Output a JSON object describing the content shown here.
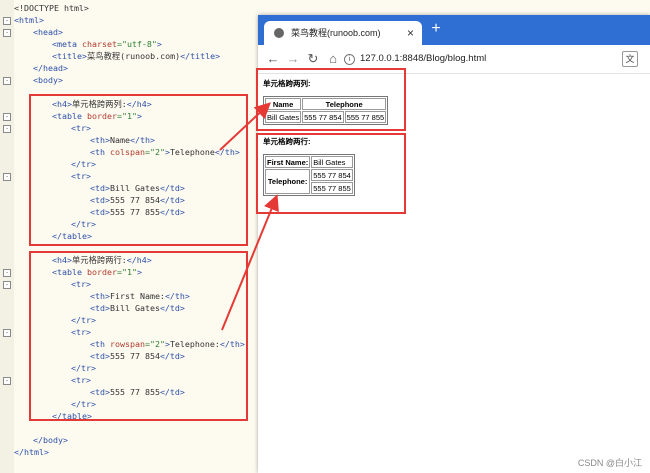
{
  "editor": {
    "lines": [
      {
        "indent": 0,
        "parts": [
          {
            "t": "<!DOCTYPE html>",
            "c": "txt"
          }
        ]
      },
      {
        "indent": 0,
        "fold": "-",
        "parts": [
          {
            "t": "<html>",
            "c": "tag"
          }
        ]
      },
      {
        "indent": 1,
        "fold": "-",
        "parts": [
          {
            "t": "<head>",
            "c": "tag"
          }
        ]
      },
      {
        "indent": 2,
        "parts": [
          {
            "t": "<meta ",
            "c": "tag"
          },
          {
            "t": "charset",
            "c": "attr"
          },
          {
            "t": "=\"utf-8\"",
            "c": "val"
          },
          {
            "t": ">",
            "c": "tag"
          }
        ]
      },
      {
        "indent": 2,
        "parts": [
          {
            "t": "<title>",
            "c": "tag"
          },
          {
            "t": "菜鸟教程(runoob.com)",
            "c": "txt"
          },
          {
            "t": "</title>",
            "c": "tag"
          }
        ]
      },
      {
        "indent": 1,
        "parts": [
          {
            "t": "</head>",
            "c": "tag"
          }
        ]
      },
      {
        "indent": 1,
        "fold": "-",
        "parts": [
          {
            "t": "<body>",
            "c": "tag"
          }
        ]
      },
      {
        "indent": 0,
        "parts": []
      },
      {
        "indent": 2,
        "parts": [
          {
            "t": "<h4>",
            "c": "tag"
          },
          {
            "t": "单元格跨两列:",
            "c": "txt"
          },
          {
            "t": "</h4>",
            "c": "tag"
          }
        ]
      },
      {
        "indent": 2,
        "fold": "-",
        "parts": [
          {
            "t": "<table ",
            "c": "tag"
          },
          {
            "t": "border",
            "c": "attr"
          },
          {
            "t": "=\"1\"",
            "c": "val"
          },
          {
            "t": ">",
            "c": "tag"
          }
        ]
      },
      {
        "indent": 3,
        "fold": "-",
        "parts": [
          {
            "t": "<tr>",
            "c": "tag"
          }
        ]
      },
      {
        "indent": 4,
        "parts": [
          {
            "t": "<th>",
            "c": "tag"
          },
          {
            "t": "Name",
            "c": "txt"
          },
          {
            "t": "</th>",
            "c": "tag"
          }
        ]
      },
      {
        "indent": 4,
        "parts": [
          {
            "t": "<th ",
            "c": "tag"
          },
          {
            "t": "colspan",
            "c": "attr"
          },
          {
            "t": "=\"2\"",
            "c": "val"
          },
          {
            "t": ">",
            "c": "tag"
          },
          {
            "t": "Telephone",
            "c": "txt"
          },
          {
            "t": "</th>",
            "c": "tag"
          }
        ]
      },
      {
        "indent": 3,
        "parts": [
          {
            "t": "</tr>",
            "c": "tag"
          }
        ]
      },
      {
        "indent": 3,
        "fold": "-",
        "parts": [
          {
            "t": "<tr>",
            "c": "tag"
          }
        ]
      },
      {
        "indent": 4,
        "parts": [
          {
            "t": "<td>",
            "c": "tag"
          },
          {
            "t": "Bill Gates",
            "c": "txt"
          },
          {
            "t": "</td>",
            "c": "tag"
          }
        ]
      },
      {
        "indent": 4,
        "parts": [
          {
            "t": "<td>",
            "c": "tag"
          },
          {
            "t": "555 77 854",
            "c": "txt"
          },
          {
            "t": "</td>",
            "c": "tag"
          }
        ]
      },
      {
        "indent": 4,
        "parts": [
          {
            "t": "<td>",
            "c": "tag"
          },
          {
            "t": "555 77 855",
            "c": "txt"
          },
          {
            "t": "</td>",
            "c": "tag"
          }
        ]
      },
      {
        "indent": 3,
        "parts": [
          {
            "t": "</tr>",
            "c": "tag"
          }
        ]
      },
      {
        "indent": 2,
        "parts": [
          {
            "t": "</table>",
            "c": "tag"
          }
        ]
      },
      {
        "indent": 0,
        "parts": []
      },
      {
        "indent": 2,
        "parts": [
          {
            "t": "<h4>",
            "c": "tag"
          },
          {
            "t": "单元格跨两行:",
            "c": "txt"
          },
          {
            "t": "</h4>",
            "c": "tag"
          }
        ]
      },
      {
        "indent": 2,
        "fold": "-",
        "parts": [
          {
            "t": "<table ",
            "c": "tag"
          },
          {
            "t": "border",
            "c": "attr"
          },
          {
            "t": "=\"1\"",
            "c": "val"
          },
          {
            "t": ">",
            "c": "tag"
          }
        ]
      },
      {
        "indent": 3,
        "fold": "-",
        "parts": [
          {
            "t": "<tr>",
            "c": "tag"
          }
        ]
      },
      {
        "indent": 4,
        "parts": [
          {
            "t": "<th>",
            "c": "tag"
          },
          {
            "t": "First Name:",
            "c": "txt"
          },
          {
            "t": "</th>",
            "c": "tag"
          }
        ]
      },
      {
        "indent": 4,
        "parts": [
          {
            "t": "<td>",
            "c": "tag"
          },
          {
            "t": "Bill Gates",
            "c": "txt"
          },
          {
            "t": "</td>",
            "c": "tag"
          }
        ]
      },
      {
        "indent": 3,
        "parts": [
          {
            "t": "</tr>",
            "c": "tag"
          }
        ]
      },
      {
        "indent": 3,
        "fold": "-",
        "parts": [
          {
            "t": "<tr>",
            "c": "tag"
          }
        ]
      },
      {
        "indent": 4,
        "parts": [
          {
            "t": "<th ",
            "c": "tag"
          },
          {
            "t": "rowspan",
            "c": "attr"
          },
          {
            "t": "=\"2\"",
            "c": "val"
          },
          {
            "t": ">",
            "c": "tag"
          },
          {
            "t": "Telephone:",
            "c": "txt"
          },
          {
            "t": "</th>",
            "c": "tag"
          }
        ]
      },
      {
        "indent": 4,
        "parts": [
          {
            "t": "<td>",
            "c": "tag"
          },
          {
            "t": "555 77 854",
            "c": "txt"
          },
          {
            "t": "</td>",
            "c": "tag"
          }
        ]
      },
      {
        "indent": 3,
        "parts": [
          {
            "t": "</tr>",
            "c": "tag"
          }
        ]
      },
      {
        "indent": 3,
        "fold": "-",
        "parts": [
          {
            "t": "<tr>",
            "c": "tag"
          }
        ]
      },
      {
        "indent": 4,
        "parts": [
          {
            "t": "<td>",
            "c": "tag"
          },
          {
            "t": "555 77 855",
            "c": "txt"
          },
          {
            "t": "</td>",
            "c": "tag"
          }
        ]
      },
      {
        "indent": 3,
        "parts": [
          {
            "t": "</tr>",
            "c": "tag"
          }
        ]
      },
      {
        "indent": 2,
        "parts": [
          {
            "t": "</table>",
            "c": "tag"
          }
        ]
      },
      {
        "indent": 0,
        "parts": []
      },
      {
        "indent": 1,
        "parts": [
          {
            "t": "</body>",
            "c": "tag"
          }
        ]
      },
      {
        "indent": 0,
        "parts": [
          {
            "t": "</html>",
            "c": "tag"
          }
        ]
      }
    ]
  },
  "browser": {
    "tab_title": "菜鸟教程(runoob.com)",
    "tab_close": "×",
    "new_tab": "+",
    "url": "127.0.0.1:8848/Blog/blog.html",
    "back": "←",
    "forward": "→",
    "reload": "↻",
    "home": "⌂",
    "translate": "文",
    "info": "i"
  },
  "page": {
    "heading1": "单元格跨两列:",
    "table1": {
      "header": [
        "Name",
        "Telephone"
      ],
      "row": [
        "Bill Gates",
        "555 77 854",
        "555 77 855"
      ]
    },
    "heading2": "单元格跨两行:",
    "table2": {
      "first_name_label": "First Name:",
      "first_name_value": "Bill Gates",
      "telephone_label": "Telephone:",
      "phone1": "555 77 854",
      "phone2": "555 77 855"
    }
  },
  "watermark": "CSDN @白小江",
  "colors": {
    "annotation": "#e53935",
    "tabbar": "#2f6ed3"
  }
}
